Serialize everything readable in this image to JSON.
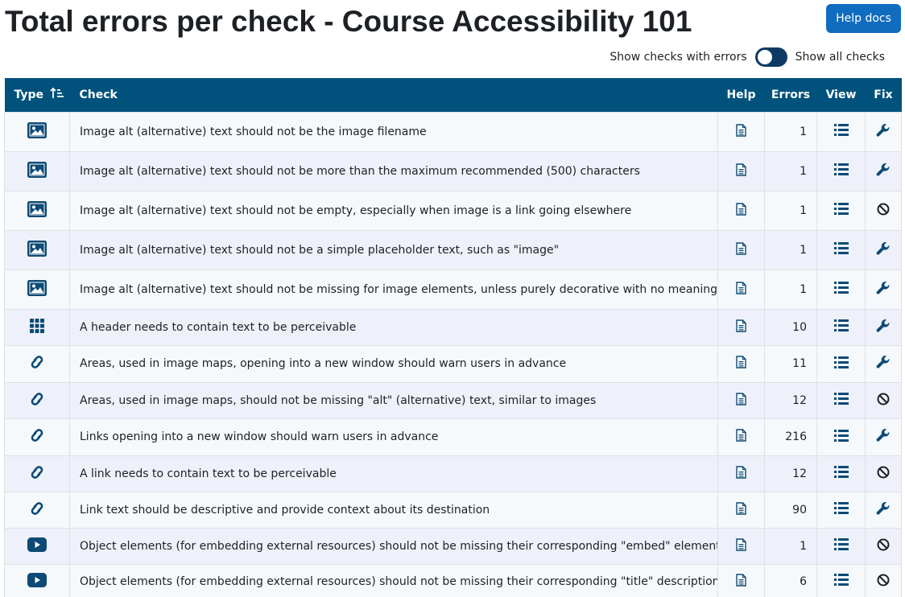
{
  "header": {
    "title": "Total errors per check - Course Accessibility 101",
    "help_docs_label": "Help docs",
    "toggle_left_label": "Show checks with errors",
    "toggle_right_label": "Show all checks"
  },
  "table": {
    "columns": {
      "type": "Type",
      "check": "Check",
      "help": "Help",
      "errors": "Errors",
      "view": "View",
      "fix": "Fix"
    },
    "rows": [
      {
        "type_icon": "image-icon",
        "check": "Image alt (alternative) text should not be the image filename",
        "errors": "1",
        "fix_icon": "wrench-icon"
      },
      {
        "type_icon": "image-icon",
        "check": "Image alt (alternative) text should not be more than the maximum recommended (500) characters",
        "errors": "1",
        "fix_icon": "wrench-icon"
      },
      {
        "type_icon": "image-icon",
        "check": "Image alt (alternative) text should not be empty, especially when image is a link going elsewhere",
        "errors": "1",
        "fix_icon": "ban-icon"
      },
      {
        "type_icon": "image-icon",
        "check": "Image alt (alternative) text should not be a simple placeholder text, such as \"image\"",
        "errors": "1",
        "fix_icon": "wrench-icon"
      },
      {
        "type_icon": "image-icon",
        "check": "Image alt (alternative) text should not be missing for image elements, unless purely decorative with no meaning",
        "errors": "1",
        "fix_icon": "wrench-icon"
      },
      {
        "type_icon": "grid-icon",
        "check": "A header needs to contain text to be perceivable",
        "errors": "10",
        "fix_icon": "wrench-icon"
      },
      {
        "type_icon": "link-icon",
        "check": "Areas, used in image maps, opening into a new window should warn users in advance",
        "errors": "11",
        "fix_icon": "wrench-icon"
      },
      {
        "type_icon": "link-icon",
        "check": "Areas, used in image maps, should not be missing \"alt\" (alternative) text, similar to images",
        "errors": "12",
        "fix_icon": "ban-icon"
      },
      {
        "type_icon": "link-icon",
        "check": "Links opening into a new window should warn users in advance",
        "errors": "216",
        "fix_icon": "wrench-icon"
      },
      {
        "type_icon": "link-icon",
        "check": "A link needs to contain text to be perceivable",
        "errors": "12",
        "fix_icon": "ban-icon"
      },
      {
        "type_icon": "link-icon",
        "check": "Link text should be descriptive and provide context about its destination",
        "errors": "90",
        "fix_icon": "wrench-icon"
      },
      {
        "type_icon": "video-icon",
        "check": "Object elements (for embedding external resources) should not be missing their corresponding \"embed\" elements",
        "errors": "1",
        "fix_icon": "ban-icon"
      },
      {
        "type_icon": "video-icon",
        "check": "Object elements (for embedding external resources) should not be missing their corresponding \"title\" descriptions",
        "errors": "6",
        "fix_icon": "ban-icon"
      }
    ]
  },
  "colors": {
    "accent": "#0f6cbf",
    "header_bg": "#00527c",
    "icon": "#0d4a75",
    "toggle": "#0d3b63"
  }
}
